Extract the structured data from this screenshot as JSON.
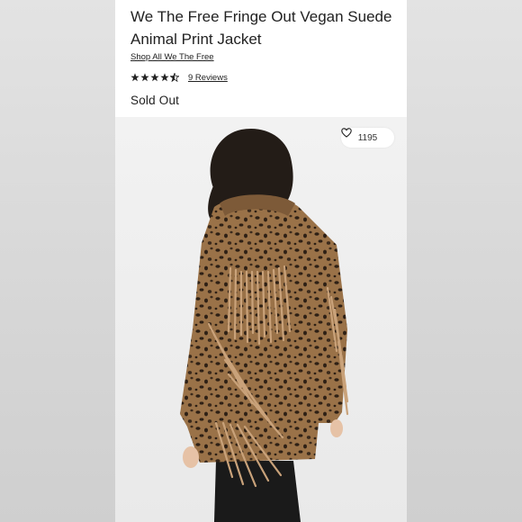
{
  "product": {
    "title": "We The Free Fringe Out Vegan Suede Animal Print Jacket",
    "shop_link": "Shop All We The Free",
    "rating": 4.5,
    "rating_max": 5,
    "reviews": "9 Reviews",
    "status": "Sold Out"
  },
  "image": {
    "likes": "1195",
    "like_icon": "heart-outline-icon"
  },
  "colors": {
    "background": "#dcdcdc",
    "card": "#ffffff",
    "text": "#222222",
    "jacket_base": "#9a7248",
    "fringe": "#c9a27a",
    "hair": "#231c17",
    "pants": "#1a1a1a"
  }
}
